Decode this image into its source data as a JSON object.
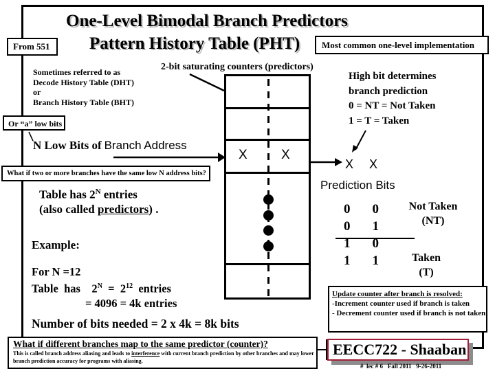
{
  "title": {
    "line1": "One-Level Bimodal Branch Predictors",
    "line2": "Pattern History Table (PHT)"
  },
  "from_tag": "From 551",
  "most_common_tag": "Most common one-level implementation",
  "also_known": {
    "line1": "Sometimes referred to as",
    "line2": "Decode History Table (DHT)",
    "line3": "or",
    "line4": "Branch History Table (BHT)"
  },
  "or_low_bits": "Or “a” low bits",
  "counters_label": "2-bit saturating counters (predictors)",
  "high_bit_note": {
    "line1": "High bit determines",
    "line2": "branch prediction",
    "line3": "0  =  NT = Not Taken",
    "line4": "1 =  T = Taken"
  },
  "n_low_bits": {
    "bold": "N  Low Bits of",
    "sans": "Branch Address"
  },
  "table_cell_x": [
    "X",
    "X"
  ],
  "output_bits": [
    "X",
    "X"
  ],
  "prediction_bits_label": "Prediction Bits",
  "same_bits_question": "What if two or more branches have the  same low N address bits?",
  "table_has": {
    "prefix": "Table has 2",
    "sup": "N",
    "suffix": " entries",
    "line2_prefix": "(also called ",
    "line2_underlined": "predictors",
    "line2_suffix": ") ."
  },
  "example_label": "Example:",
  "example": {
    "line1": "For  N =12",
    "line2_a": "Table  has    2",
    "line2_sup1": "N",
    "line2_b": "  =  2",
    "line2_sup2": "12",
    "line2_c": "  entries",
    "line3": "=  4096 =  4k entries"
  },
  "bits_needed": "Number of bits needed =  2 x 4k = 8k bits",
  "state_table": {
    "rows": [
      [
        "0",
        "0"
      ],
      [
        "0",
        "1"
      ],
      [
        "1",
        "0"
      ],
      [
        "1",
        "1"
      ]
    ],
    "not_taken_label": "Not Taken",
    "not_taken_abbr": "(NT)",
    "taken_label": "Taken",
    "taken_abbr": "(T)"
  },
  "update_box": {
    "heading": "Update counter after branch is resolved:",
    "line1": "-Increment counter used if branch is taken",
    "line2": "- Decrement counter used if branch is not taken"
  },
  "aliasing_box": {
    "heading": "What if different branches map to the same predictor (counter)?",
    "body_a": "This is called branch address aliasing and leads to ",
    "body_underlined": "interference",
    "body_b": " with current branch prediction by other branches and may lower branch prediction accuracy for programs with aliasing."
  },
  "course_badge": "EECC722 - Shaaban",
  "footer": "#  lec # 6   Fall 2011   9-26-2011",
  "colors": {
    "badge_border": "#a0203a",
    "badge_shadow": "#8c8c8c",
    "title_shadow": "#b8b8b8"
  }
}
